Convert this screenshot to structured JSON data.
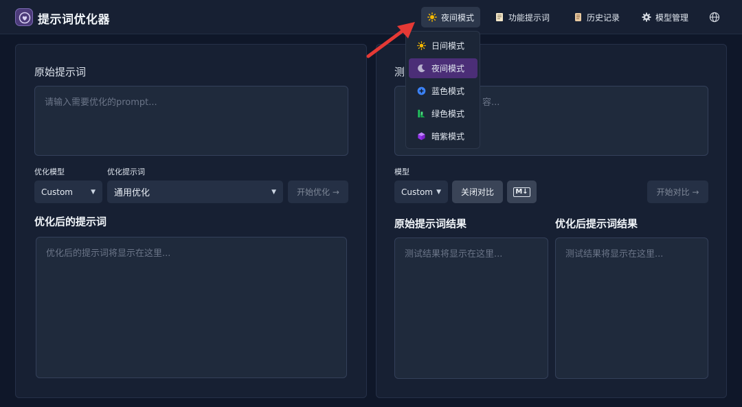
{
  "app": {
    "title": "提示词优化器"
  },
  "nav": {
    "theme": "夜间模式",
    "feature_prompts": "功能提示词",
    "history": "历史记录",
    "model_manage": "模型管理"
  },
  "theme_menu": {
    "items": [
      {
        "label": "日间模式",
        "icon": "sun-icon"
      },
      {
        "label": "夜间模式",
        "icon": "moon-icon"
      },
      {
        "label": "蓝色模式",
        "icon": "plus-circle-icon"
      },
      {
        "label": "绿色模式",
        "icon": "green-logo-icon"
      },
      {
        "label": "暗紫模式",
        "icon": "cube-icon"
      }
    ],
    "selected": "夜间模式"
  },
  "left": {
    "original_title": "原始提示词",
    "input_placeholder": "请输入需要优化的prompt...",
    "model_label": "优化模型",
    "prompt_label": "优化提示词",
    "model_value": "Custom",
    "prompt_value": "通用优化",
    "start_btn": "开始优化 →",
    "optimized_title": "优化后的提示词",
    "output_placeholder": "优化后的提示词将显示在这里..."
  },
  "right": {
    "test_title_partial": "测",
    "test_input_partial": "容...",
    "model_label": "模型",
    "model_value": "Custom",
    "close_compare": "关闭对比",
    "md_badge": "M↓",
    "start_compare": "开始对比 →",
    "orig_result_title": "原始提示词结果",
    "opt_result_title": "优化后提示词结果",
    "result_placeholder": "测试结果将显示在这里..."
  },
  "colors": {
    "background": "#0f1729",
    "panel": "#172033",
    "accent_purple": "#4b2e77",
    "arrow_red": "#e53935"
  }
}
